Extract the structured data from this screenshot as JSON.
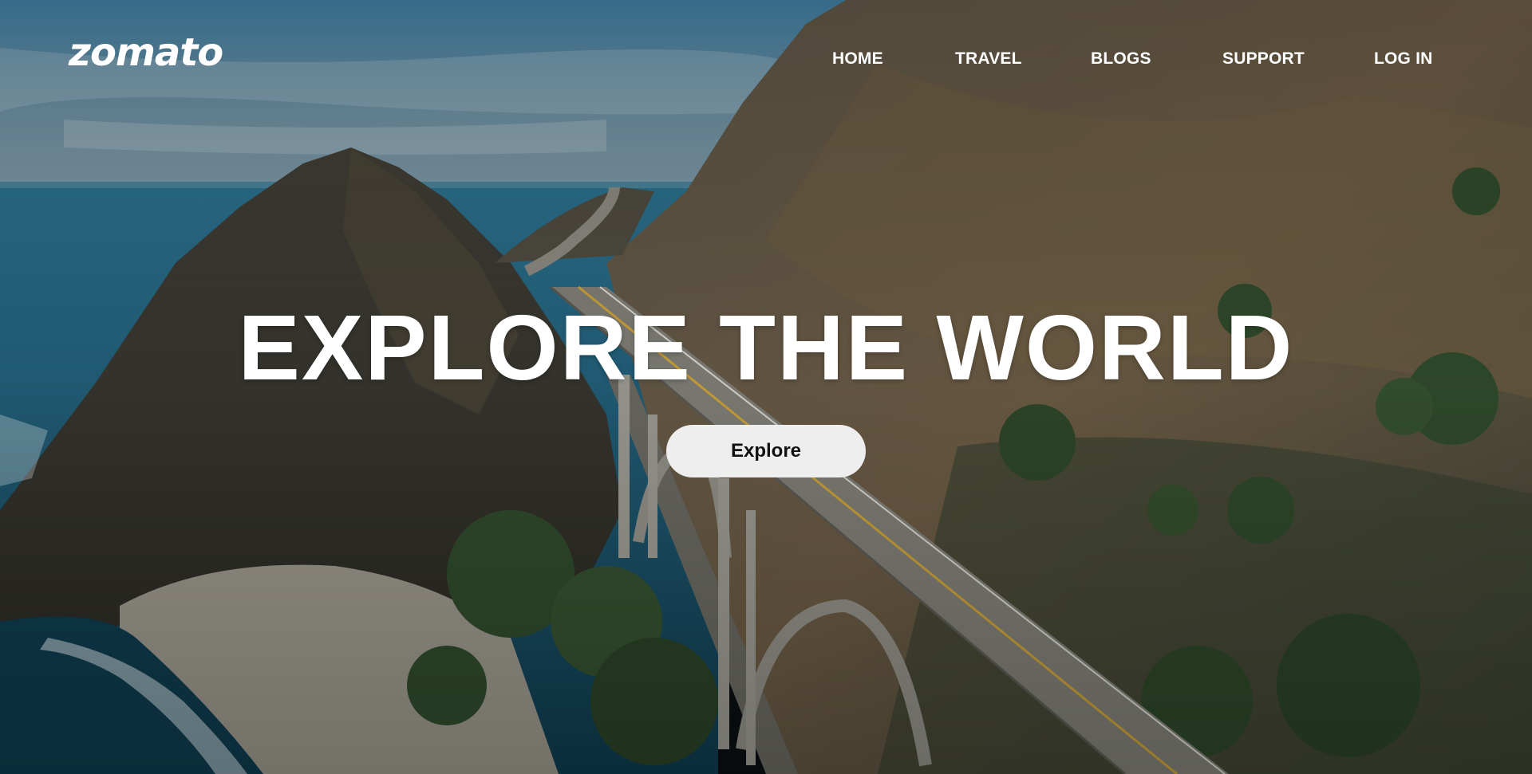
{
  "brand": {
    "logo_text": "zomato"
  },
  "nav": {
    "items": [
      {
        "label": "HOME"
      },
      {
        "label": "TRAVEL"
      },
      {
        "label": "BLOGS"
      },
      {
        "label": "SUPPORT"
      },
      {
        "label": "LOG IN"
      }
    ]
  },
  "hero": {
    "headline": "EXPLORE THE WORLD",
    "cta_label": "Explore",
    "background_image": "coastal-mountain-bridge-aerial"
  },
  "colors": {
    "text": "#ffffff",
    "button_bg": "#eeeeee",
    "button_text": "#111111",
    "sea": "#1e5f7a",
    "sky": "#4f7c95",
    "mountain": "#4a4538",
    "road": "#7c7b73",
    "road_line": "#c9a03a"
  }
}
